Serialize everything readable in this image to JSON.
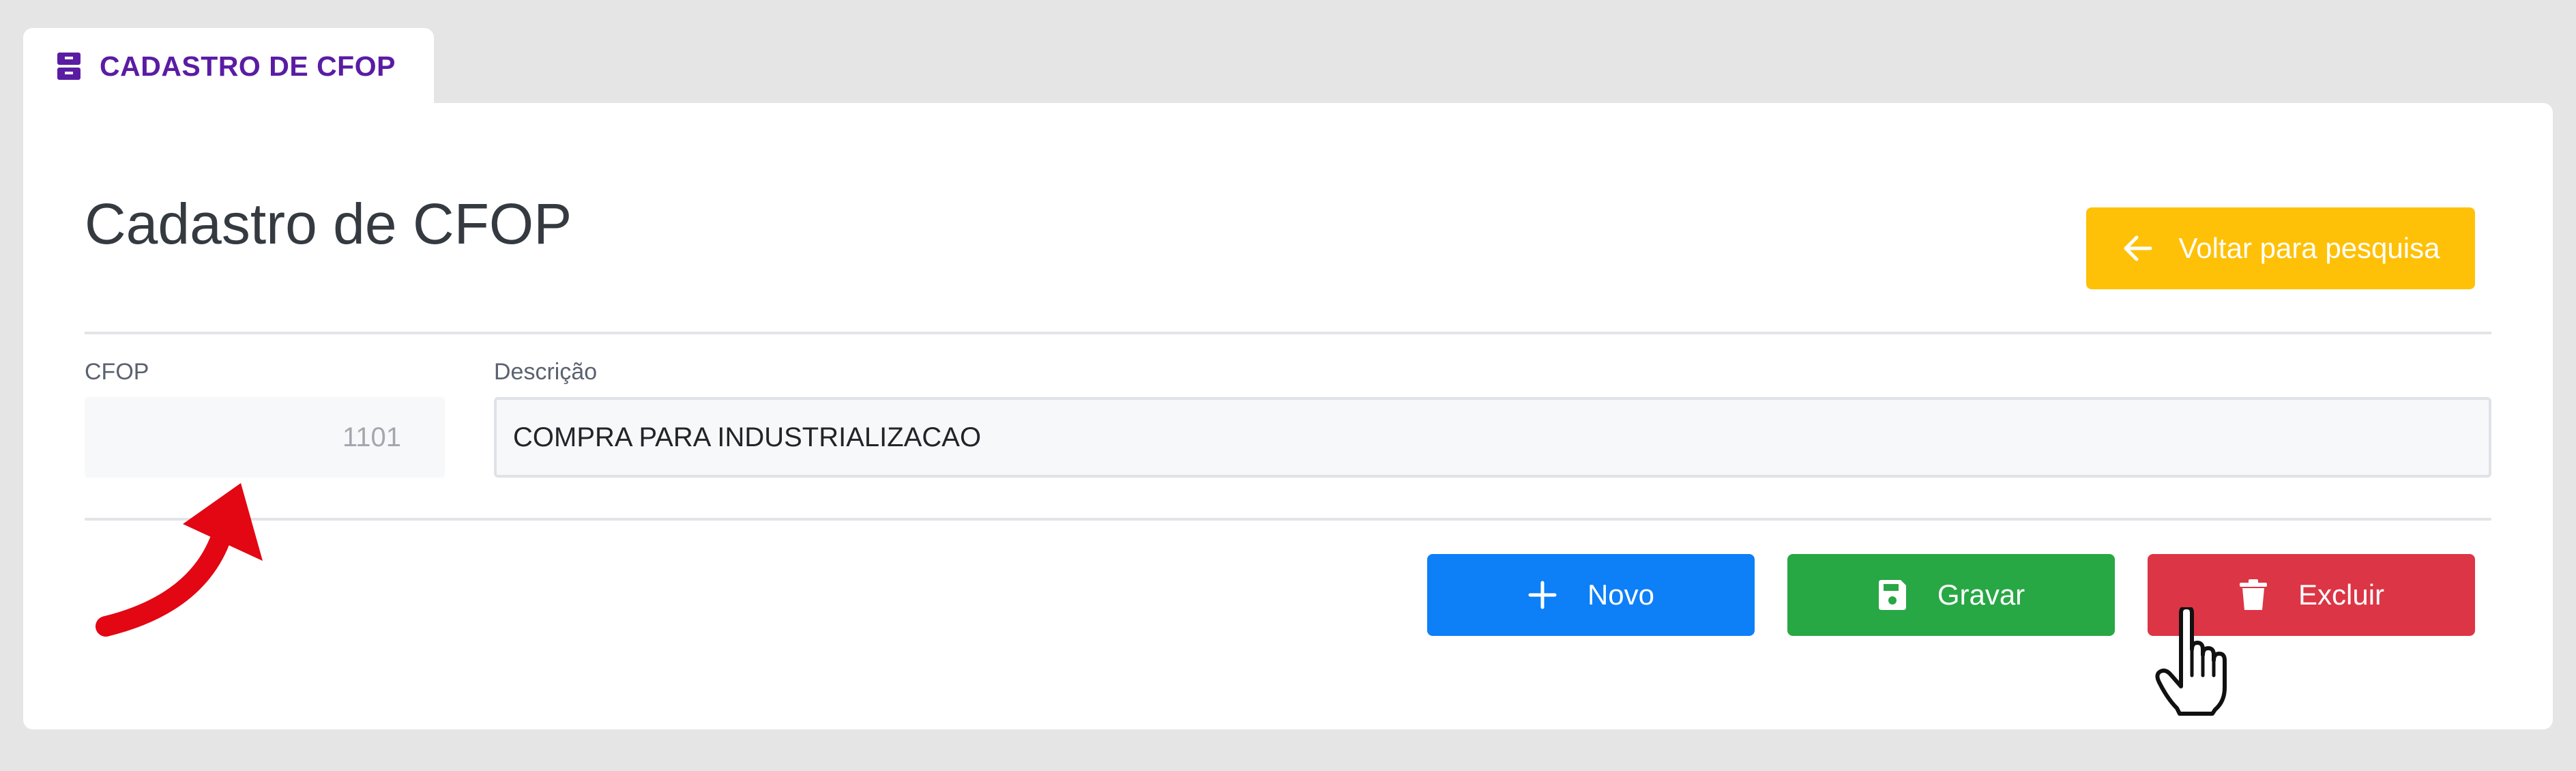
{
  "tab": {
    "label": "CADASTRO DE CFOP",
    "icon": "archive-icon"
  },
  "page": {
    "title": "Cadastro de CFOP"
  },
  "back_button": {
    "label": "Voltar para pesquisa",
    "icon": "arrow-left-icon",
    "color": "#ffc107"
  },
  "form": {
    "cfop": {
      "label": "CFOP",
      "value": "1101"
    },
    "descricao": {
      "label": "Descrição",
      "value": "COMPRA PARA INDUSTRIALIZACAO"
    }
  },
  "actions": {
    "novo": {
      "label": "Novo",
      "icon": "plus-icon",
      "color": "#0d7ff7"
    },
    "gravar": {
      "label": "Gravar",
      "icon": "save-icon",
      "color": "#28a745"
    },
    "excluir": {
      "label": "Excluir",
      "icon": "trash-icon",
      "color": "#dc3545"
    }
  },
  "annotations": {
    "arrow": "red-arrow-icon",
    "cursor": "hand-pointer-icon"
  },
  "colors": {
    "brand": "#5a1ca3",
    "background": "#e5e5e5",
    "arrow": "#e30613"
  }
}
